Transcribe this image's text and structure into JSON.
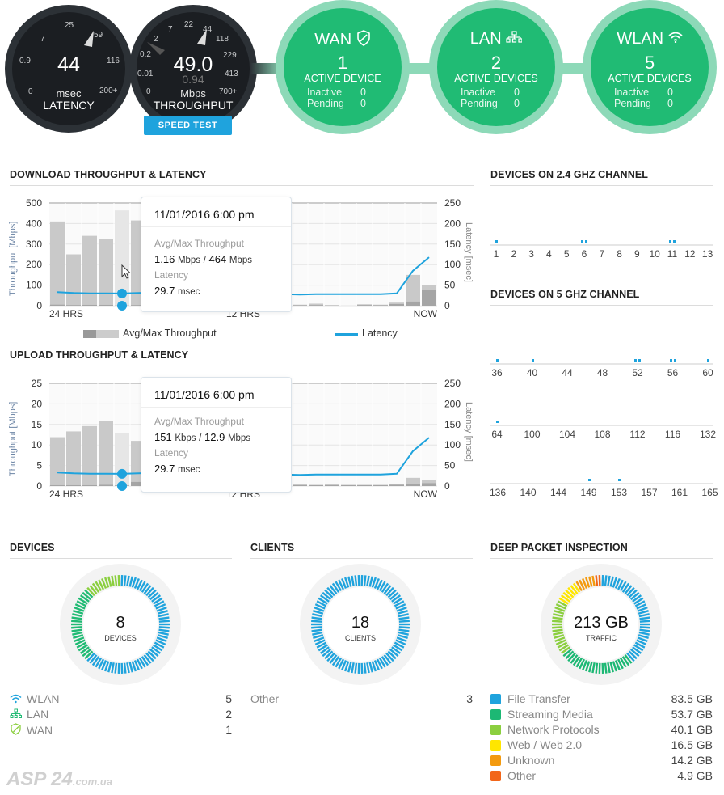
{
  "gauges": {
    "latency": {
      "value": "44",
      "unit": "msec",
      "label": "LATENCY",
      "ticks": [
        "0",
        "0.9",
        "7",
        "25",
        "59",
        "116",
        "200+"
      ]
    },
    "throughput": {
      "value": "49.0",
      "sub_value": "0.94",
      "unit": "Mbps",
      "label": "THROUGHPUT",
      "ticks": [
        "0",
        "0.01",
        "0.2",
        "2",
        "7",
        "22",
        "44",
        "118",
        "229",
        "413",
        "700+"
      ]
    },
    "speed_test_label": "SPEED TEST"
  },
  "status_circles": [
    {
      "title": "WAN",
      "icon": "shield-icon",
      "count": "1",
      "sub": "ACTIVE DEVICE",
      "inactive_label": "Inactive",
      "inactive": "0",
      "pending_label": "Pending",
      "pending": "0"
    },
    {
      "title": "LAN",
      "icon": "network-icon",
      "count": "2",
      "sub": "ACTIVE DEVICES",
      "inactive_label": "Inactive",
      "inactive": "0",
      "pending_label": "Pending",
      "pending": "0"
    },
    {
      "title": "WLAN",
      "icon": "wifi-icon",
      "count": "5",
      "sub": "ACTIVE DEVICES",
      "inactive_label": "Inactive",
      "inactive": "0",
      "pending_label": "Pending",
      "pending": "0"
    }
  ],
  "download": {
    "title": "DOWNLOAD THROUGHPUT & LATENCY",
    "ylabel_left": "Throughput [Mbps]",
    "ylabel_right": "Latency [msec]",
    "yticks_left": [
      "500",
      "400",
      "300",
      "200",
      "100",
      "0"
    ],
    "yticks_right": [
      "250",
      "200",
      "150",
      "100",
      "50",
      "0"
    ],
    "xticks": [
      "24 HRS",
      "12 HRS",
      "NOW"
    ],
    "tooltip": {
      "date": "11/01/2016 6:00 pm",
      "tp_label": "Avg/Max Throughput",
      "avg": "1.16",
      "avg_unit": "Mbps",
      "sep": "/",
      "max": "464",
      "max_unit": "Mbps",
      "lat_label": "Latency",
      "lat": "29.7",
      "lat_unit": "msec"
    },
    "legend_bars": "Avg/Max Throughput",
    "legend_line": "Latency"
  },
  "upload": {
    "title": "UPLOAD THROUGHPUT & LATENCY",
    "ylabel_left": "Throughput [Mbps]",
    "ylabel_right": "Latency [msec]",
    "yticks_left": [
      "25",
      "20",
      "15",
      "10",
      "5",
      "0"
    ],
    "yticks_right": [
      "250",
      "200",
      "150",
      "100",
      "50",
      "0"
    ],
    "xticks": [
      "24 HRS",
      "12 HRS",
      "NOW"
    ],
    "tooltip": {
      "date": "11/01/2016 6:00 pm",
      "tp_label": "Avg/Max Throughput",
      "avg": "151",
      "avg_unit": "Kbps",
      "sep": "/",
      "max": "12.9",
      "max_unit": "Mbps",
      "lat_label": "Latency",
      "lat": "29.7",
      "lat_unit": "msec"
    }
  },
  "chart_data": [
    {
      "type": "bar",
      "title": "DOWNLOAD THROUGHPUT & LATENCY",
      "ylabel": "Throughput [Mbps]",
      "ylabel_right": "Latency [msec]",
      "ylim": [
        0,
        500
      ],
      "ylim_right": [
        0,
        250
      ],
      "x": [
        "24 HRS",
        "",
        "",
        "",
        "",
        "",
        "",
        "",
        "",
        "",
        "",
        "",
        "12 HRS",
        "",
        "",
        "",
        "",
        "",
        "",
        "",
        "",
        "",
        "",
        "NOW"
      ],
      "series": [
        {
          "name": "Max Throughput",
          "values": [
            410,
            250,
            340,
            325,
            464,
            415,
            0,
            0,
            0,
            0,
            0,
            0,
            0,
            0,
            0,
            5,
            10,
            3,
            0,
            7,
            5,
            15,
            150,
            100
          ]
        },
        {
          "name": "Avg Throughput",
          "values": [
            5,
            3,
            4,
            4,
            1.16,
            3,
            0,
            0,
            0,
            0,
            0,
            0,
            0,
            0,
            0,
            2,
            3,
            1,
            0,
            3,
            2,
            8,
            20,
            75
          ]
        },
        {
          "name": "Latency",
          "type": "line",
          "values": [
            33,
            31,
            30,
            30,
            29.7,
            31,
            32,
            33,
            35,
            38,
            36,
            30,
            28,
            28,
            28,
            27,
            28,
            28,
            28,
            28,
            28,
            30,
            85,
            118
          ]
        }
      ],
      "legend": [
        "Avg/Max Throughput",
        "Latency"
      ],
      "grid": true
    },
    {
      "type": "bar",
      "title": "UPLOAD THROUGHPUT & LATENCY",
      "ylabel": "Throughput [Mbps]",
      "ylabel_right": "Latency [msec]",
      "ylim": [
        0,
        25
      ],
      "ylim_right": [
        0,
        250
      ],
      "x": [
        "24 HRS",
        "",
        "",
        "",
        "",
        "",
        "",
        "",
        "",
        "",
        "",
        "",
        "12 HRS",
        "",
        "",
        "",
        "",
        "",
        "",
        "",
        "",
        "",
        "",
        "NOW"
      ],
      "series": [
        {
          "name": "Max Throughput",
          "values": [
            11.9,
            13.3,
            14.6,
            15.9,
            12.9,
            11,
            1,
            1,
            0,
            0,
            0,
            0,
            1.5,
            0.5,
            0.3,
            0.5,
            0.3,
            0.5,
            0.3,
            0.3,
            0.3,
            0.5,
            2,
            1.5
          ]
        },
        {
          "name": "Avg Throughput",
          "values": [
            0.2,
            0.2,
            0.2,
            0.3,
            0.151,
            1,
            0.3,
            0.3,
            0,
            0,
            0,
            0,
            0.3,
            0.2,
            0.2,
            0.2,
            0.2,
            0.2,
            0.2,
            0.2,
            0.2,
            0.3,
            0.5,
            0.7
          ]
        },
        {
          "name": "Latency",
          "type": "line",
          "values": [
            33,
            31,
            30,
            30,
            29.7,
            31,
            32,
            33,
            35,
            38,
            36,
            30,
            28,
            28,
            28,
            27,
            28,
            28,
            28,
            28,
            28,
            30,
            85,
            118
          ]
        }
      ],
      "legend": [
        "Avg/Max Throughput",
        "Latency"
      ],
      "grid": true
    }
  ],
  "channels24": {
    "title": "DEVICES ON 2.4 GHZ CHANNEL",
    "channels": [
      "1",
      "2",
      "3",
      "4",
      "5",
      "6",
      "7",
      "8",
      "9",
      "10",
      "11",
      "12",
      "13"
    ],
    "device_counts": [
      1,
      0,
      0,
      0,
      0,
      2,
      0,
      0,
      0,
      0,
      2,
      0,
      0
    ]
  },
  "channels5": {
    "title": "DEVICES ON 5 GHZ CHANNEL",
    "rows": [
      {
        "channels": [
          "36",
          "40",
          "44",
          "48",
          "52",
          "56",
          "60"
        ],
        "device_counts": [
          1,
          1,
          0,
          0,
          2,
          2,
          1
        ]
      },
      {
        "channels": [
          "64",
          "100",
          "104",
          "108",
          "112",
          "116",
          "132"
        ],
        "device_counts": [
          1,
          0,
          0,
          0,
          0,
          0,
          0
        ]
      },
      {
        "channels": [
          "136",
          "140",
          "144",
          "149",
          "153",
          "157",
          "161",
          "165"
        ],
        "device_counts": [
          0,
          0,
          0,
          1,
          1,
          0,
          0,
          0
        ]
      }
    ]
  },
  "devices": {
    "title": "DEVICES",
    "total": "8",
    "total_label": "DEVICES",
    "items": [
      {
        "label": "WLAN",
        "icon": "wifi-icon",
        "value": "5",
        "color": "#1fa3dd"
      },
      {
        "label": "LAN",
        "icon": "network-icon",
        "value": "2",
        "color": "#20bb74"
      },
      {
        "label": "WAN",
        "icon": "shield-icon",
        "value": "1",
        "color": "#8bcf3f"
      }
    ]
  },
  "clients": {
    "title": "CLIENTS",
    "total": "18",
    "total_label": "CLIENTS",
    "items": [
      {
        "label": "Other",
        "value": "3",
        "color": "#1fa3dd"
      }
    ]
  },
  "dpi": {
    "title": "DEEP PACKET INSPECTION",
    "total": "213 GB",
    "total_label": "TRAFFIC",
    "items": [
      {
        "label": "File Transfer",
        "value": "83.5 GB",
        "color": "#1fa3dd"
      },
      {
        "label": "Streaming Media",
        "value": "53.7 GB",
        "color": "#1cb874"
      },
      {
        "label": "Network Protocols",
        "value": "40.1 GB",
        "color": "#8bcf3f"
      },
      {
        "label": "Web / Web 2.0",
        "value": "16.5 GB",
        "color": "#ffe600"
      },
      {
        "label": "Unknown",
        "value": "14.2 GB",
        "color": "#f39a0f"
      },
      {
        "label": "Other",
        "value": "4.9 GB",
        "color": "#f2661a"
      }
    ]
  },
  "watermark": {
    "main": "ASP 24",
    "suffix": ".com.ua"
  }
}
